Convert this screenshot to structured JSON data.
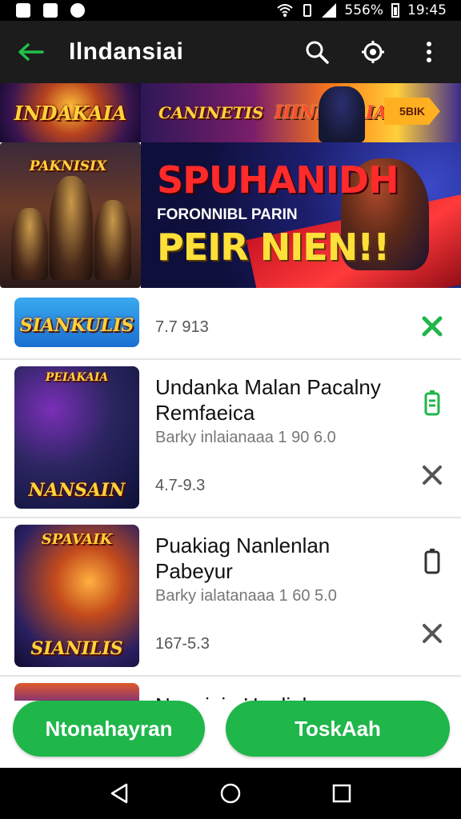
{
  "status_bar": {
    "battery_text": "556%",
    "time": "19:45"
  },
  "app_bar": {
    "title": "Ilndansiai"
  },
  "banner_top": {
    "left_text": "INDAKAIA",
    "mid_text_1": "CANINETIS",
    "mid_text_2": "IIINKSIAIA",
    "badge": "5BIK"
  },
  "banner_main": {
    "left_text": "PAKNISIX",
    "headline": "SPUHANIDH",
    "subline": "FORONNIBL PARIN",
    "tagline": "PEIR NIEN!!"
  },
  "list": {
    "items": [
      {
        "thumb_text": "SIANKULIS",
        "title": "",
        "subtitle": "",
        "meta": "7.7 913"
      },
      {
        "thumb_text": "NANSAIN",
        "thumb_top": "PEIAKAIA",
        "title": "Undanka Malan Pacalny Remfaeica",
        "subtitle": "Barky inlaianaaa 1 90 6.0",
        "meta": "4.7-9.3"
      },
      {
        "thumb_text": "SIANILIS",
        "thumb_top": "SPAVAIK",
        "title": "Puakiag Nanlenlan Pabeyur",
        "subtitle": "Barky ialatanaaa 1 60 5.0",
        "meta": "167-5.3"
      },
      {
        "thumb_text": "",
        "title": "Nagaiaiu Haaliah",
        "subtitle": "",
        "meta": ""
      }
    ]
  },
  "buttons": {
    "left_label": "Ntonahayran",
    "right_label": "ToskAah"
  },
  "colors": {
    "accent_green": "#1fb64a",
    "app_bar": "#1c1c1c"
  }
}
